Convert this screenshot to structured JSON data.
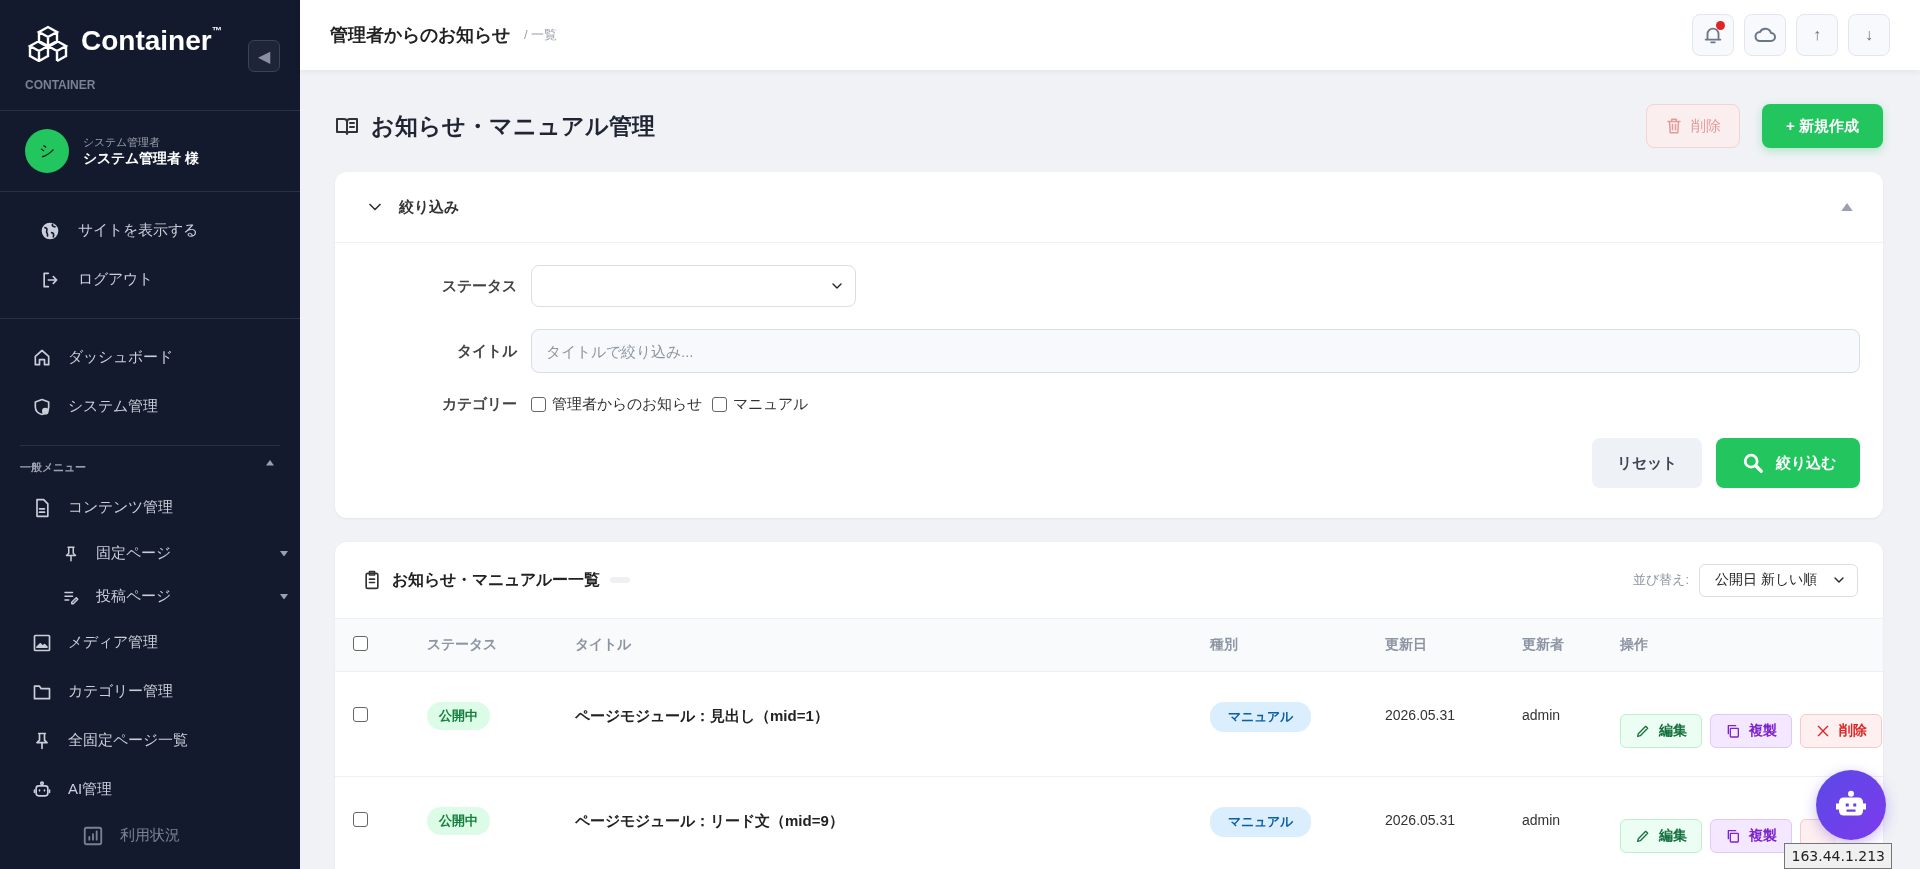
{
  "sidebar": {
    "logo": "Container",
    "trademark": "™",
    "subtitle": "CONTAINER",
    "collapse_button": "◀",
    "user": {
      "avatar": "シ",
      "role": "システム管理者",
      "name": "システム管理者 様"
    },
    "links": [
      {
        "label": "サイトを表示する"
      },
      {
        "label": "ログアウト"
      }
    ],
    "top_items": [
      {
        "label": "ダッシュボード"
      },
      {
        "label": "システム管理"
      }
    ],
    "section": {
      "label": "一般メニュー",
      "expanded": true
    },
    "items": [
      {
        "label": "コンテンツ管理",
        "children": [
          {
            "label": "固定ページ",
            "expanded": false
          },
          {
            "label": "投稿ページ",
            "expanded": false
          }
        ]
      },
      {
        "label": "メディア管理"
      },
      {
        "label": "カテゴリー管理"
      },
      {
        "label": "全固定ページ一覧"
      },
      {
        "label": "AI管理",
        "children": [
          {
            "label": "利用状況"
          }
        ]
      }
    ]
  },
  "header": {
    "title": "管理者からのお知らせ",
    "breadcrumb": "/ 一覧",
    "notification": true,
    "up": "↑",
    "down": "↓"
  },
  "page": {
    "title": "お知らせ・マニュアル管理",
    "delete_button": {
      "label": "削除",
      "disabled": true
    },
    "create_button": "+ 新規作成"
  },
  "filter": {
    "title": "絞り込み",
    "expanded": true,
    "status_label": "ステータス",
    "title_label": "タイトル",
    "title_placeholder": "タイトルで絞り込み...",
    "category_label": "カテゴリー",
    "categories": [
      {
        "label": "管理者からのお知らせ",
        "checked": false
      },
      {
        "label": "マニュアル",
        "checked": false
      }
    ],
    "reset_button": "リセット",
    "search_button": "絞り込む"
  },
  "list": {
    "title": "お知らせ・マニュアルー一覧",
    "sort_label": "並び替え:",
    "sort_value": "公開日 新しい順",
    "columns": [
      "ステータス",
      "タイトル",
      "種別",
      "更新日",
      "更新者",
      "操作"
    ],
    "select_all": false,
    "rows": [
      {
        "checked": false,
        "status": "公開中",
        "title": "ページモジュール：見出し（mid=1）",
        "type": "マニュアル",
        "date": "2026.05.31",
        "user": "admin",
        "actions": [
          {
            "kind": "edit",
            "label": "編集"
          },
          {
            "kind": "copy",
            "label": "複製"
          },
          {
            "kind": "delete",
            "label": "削除"
          }
        ]
      },
      {
        "checked": false,
        "status": "公開中",
        "title": "ページモジュール：リード文（mid=9）",
        "type": "マニュアル",
        "date": "2026.05.31",
        "user": "admin",
        "actions": [
          {
            "kind": "edit",
            "label": "編集"
          },
          {
            "kind": "copy",
            "label": "複製"
          },
          {
            "kind": "delete"
          }
        ]
      }
    ]
  },
  "tooltip": "163.44.1.213"
}
